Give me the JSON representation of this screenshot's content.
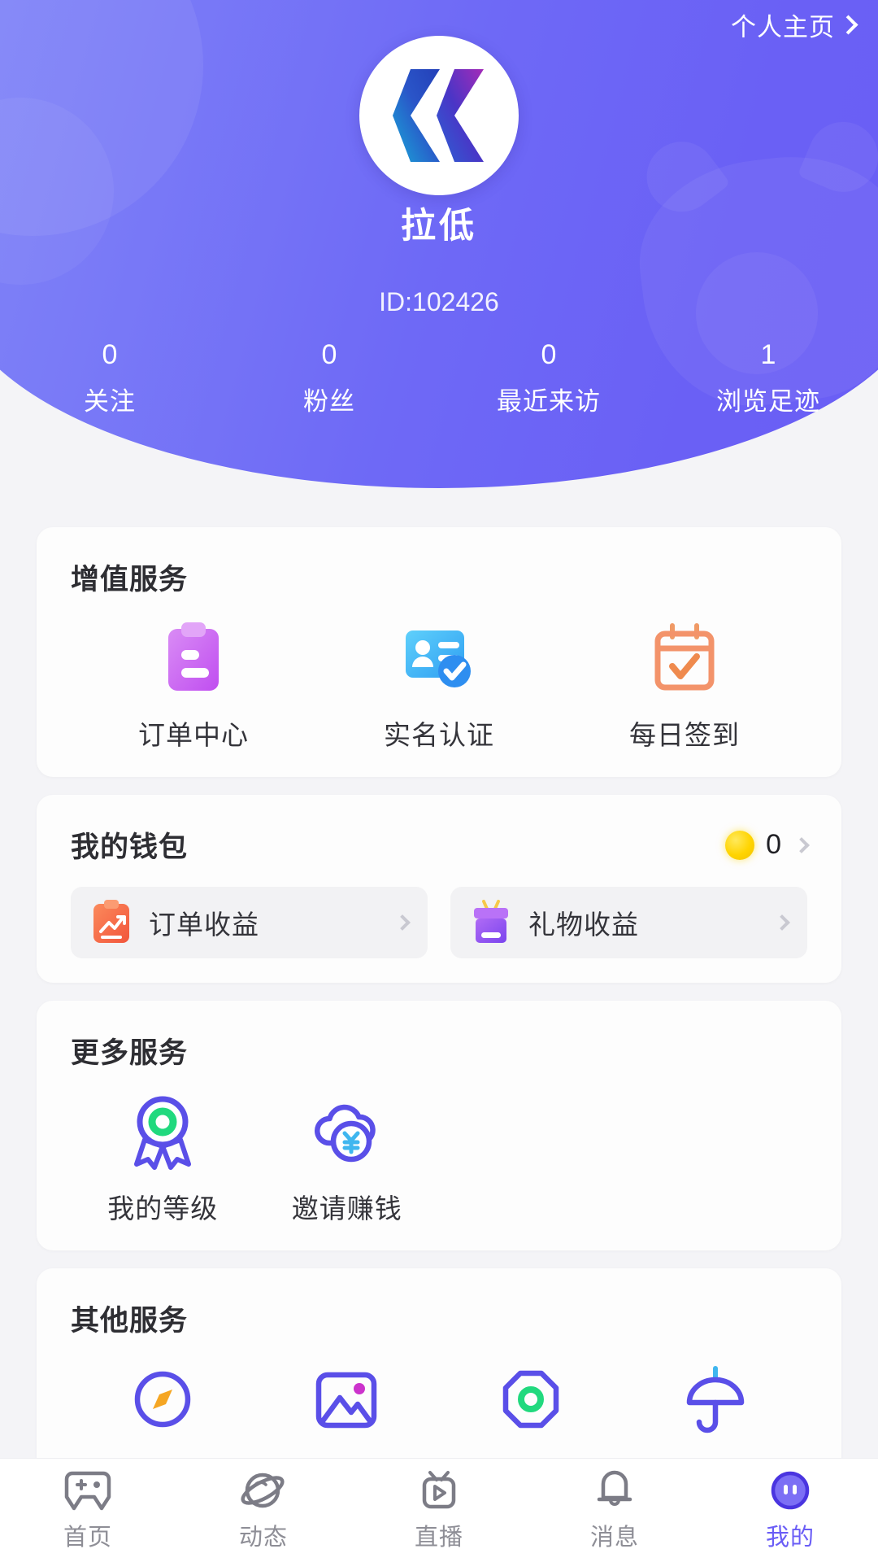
{
  "header": {
    "home_link": "个人主页",
    "username": "拉低",
    "user_id": "ID:102426",
    "accent_color": "#6A5DF6",
    "stats": [
      {
        "value": "0",
        "label": "关注"
      },
      {
        "value": "0",
        "label": "粉丝"
      },
      {
        "value": "0",
        "label": "最近来访"
      },
      {
        "value": "1",
        "label": "浏览足迹"
      }
    ]
  },
  "value_added": {
    "title": "增值服务",
    "items": [
      {
        "label": "订单中心",
        "icon": "clipboard-icon",
        "color": "#C86BF2"
      },
      {
        "label": "实名认证",
        "icon": "id-card-verified-icon",
        "color": "#44B6F7"
      },
      {
        "label": "每日签到",
        "icon": "calendar-check-icon",
        "color": "#F5935F"
      }
    ]
  },
  "wallet": {
    "title": "我的钱包",
    "coin_icon": "coin-icon",
    "balance": "0",
    "arrow_icon": "chevron-right-icon",
    "buttons": [
      {
        "label": "订单收益",
        "icon": "order-earnings-icon",
        "color": "#F4704A"
      },
      {
        "label": "礼物收益",
        "icon": "gift-earnings-icon",
        "color": "#8B5CF6"
      }
    ]
  },
  "more_services": {
    "title": "更多服务",
    "items": [
      {
        "label": "我的等级",
        "icon": "medal-icon",
        "color": "#5A4FE8"
      },
      {
        "label": "邀请赚钱",
        "icon": "cloud-yuan-icon",
        "color": "#5A4FE8"
      }
    ]
  },
  "other_services": {
    "title": "其他服务",
    "items": [
      {
        "label": "",
        "icon": "compass-icon",
        "color": "#5A4FE8"
      },
      {
        "label": "",
        "icon": "image-gallery-icon",
        "color": "#5A4FE8"
      },
      {
        "label": "",
        "icon": "octagon-ring-icon",
        "color": "#5A4FE8"
      },
      {
        "label": "",
        "icon": "umbrella-icon",
        "color": "#5A4FE8"
      }
    ]
  },
  "tabbar": {
    "items": [
      {
        "label": "首页",
        "icon": "gamepad-icon",
        "active": false
      },
      {
        "label": "动态",
        "icon": "planet-icon",
        "active": false
      },
      {
        "label": "直播",
        "icon": "tv-play-icon",
        "active": false
      },
      {
        "label": "消息",
        "icon": "bell-icon",
        "active": false
      },
      {
        "label": "我的",
        "icon": "profile-face-icon",
        "active": true
      }
    ]
  }
}
